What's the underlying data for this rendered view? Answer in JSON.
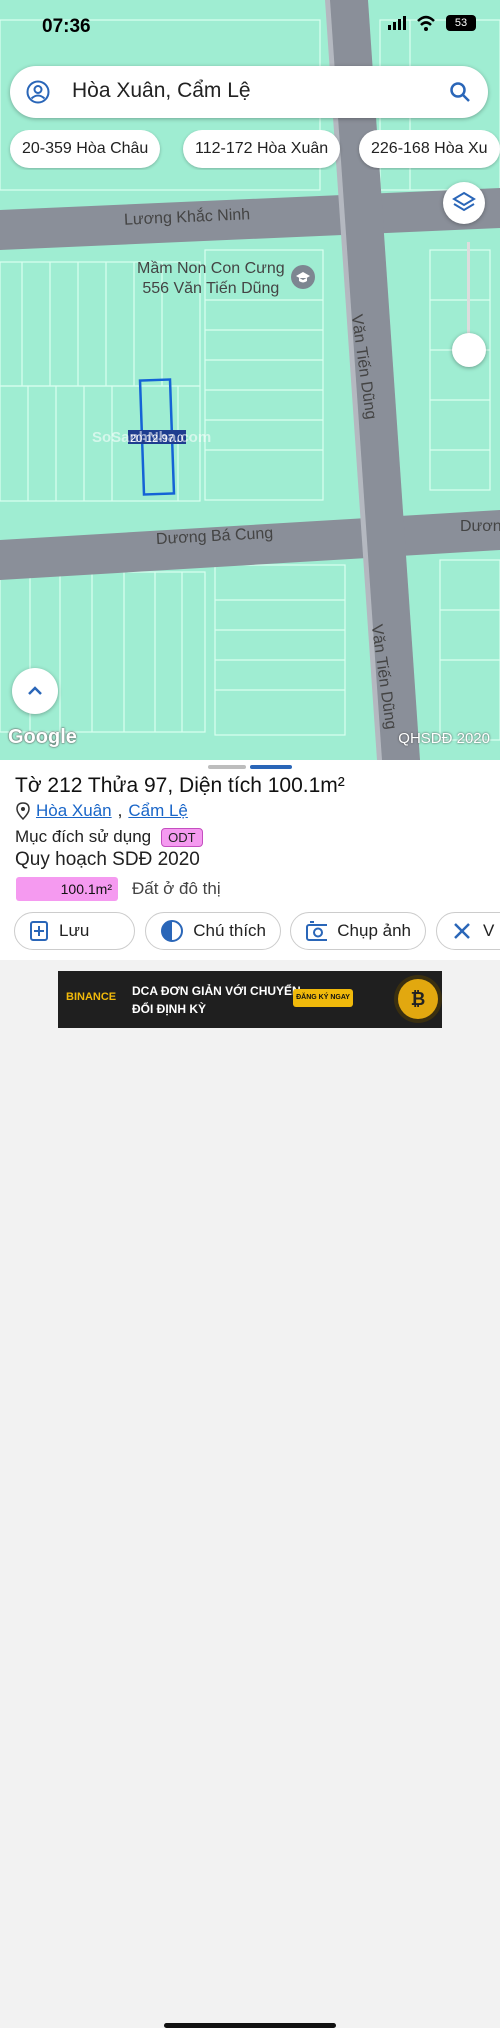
{
  "status": {
    "time": "07:36",
    "battery": "53"
  },
  "search": {
    "query": "Hòa Xuân, Cẩm Lệ"
  },
  "chips": [
    "20-359 Hòa Châu",
    "112-172 Hòa Xuân",
    "226-168 Hòa Xu"
  ],
  "map": {
    "streets": [
      "Lương Khắc Ninh",
      "Dương Bá Cung",
      "Văn Tiến Dũng",
      "Văn Tiến Dũng",
      "Dươn"
    ],
    "poi": {
      "name": "Mầm Non Con Cưng",
      "address": "556 Văn Tiến Dũng"
    },
    "parcel_label": "20-12-97.0",
    "watermark": "SoSanhNha.com",
    "attribution": "Google",
    "layer_tag": "QHSDĐ 2020"
  },
  "parcel": {
    "title": "Tờ 212 Thửa 97, Diện tích 100.1m²",
    "ward": "Hòa Xuân",
    "separator": ",",
    "district": "Cẩm Lệ",
    "purpose_label": "Mục đích sử dụng",
    "purpose_code": "ODT",
    "plan_label": "Quy hoạch SDĐ 2020",
    "plan_area": "100.1m²",
    "plan_desc": "Đất ở đô thị"
  },
  "actions": {
    "save": "Lưu",
    "legend": "Chú thích",
    "capture": "Chụp ảnh",
    "more": "V"
  },
  "ad": {
    "brand": "BINANCE",
    "line1": "DCA ĐƠN GIẢN VỚI CHUYỂN",
    "line2": "ĐỔI ĐỊNH KỲ",
    "cta": "ĐĂNG KÝ NGAY",
    "coin": "₿"
  },
  "colors": {
    "land": "#9fedd2",
    "road": "#8a8f99",
    "accent": "#1a66c8",
    "parcel": "#f59af0"
  }
}
